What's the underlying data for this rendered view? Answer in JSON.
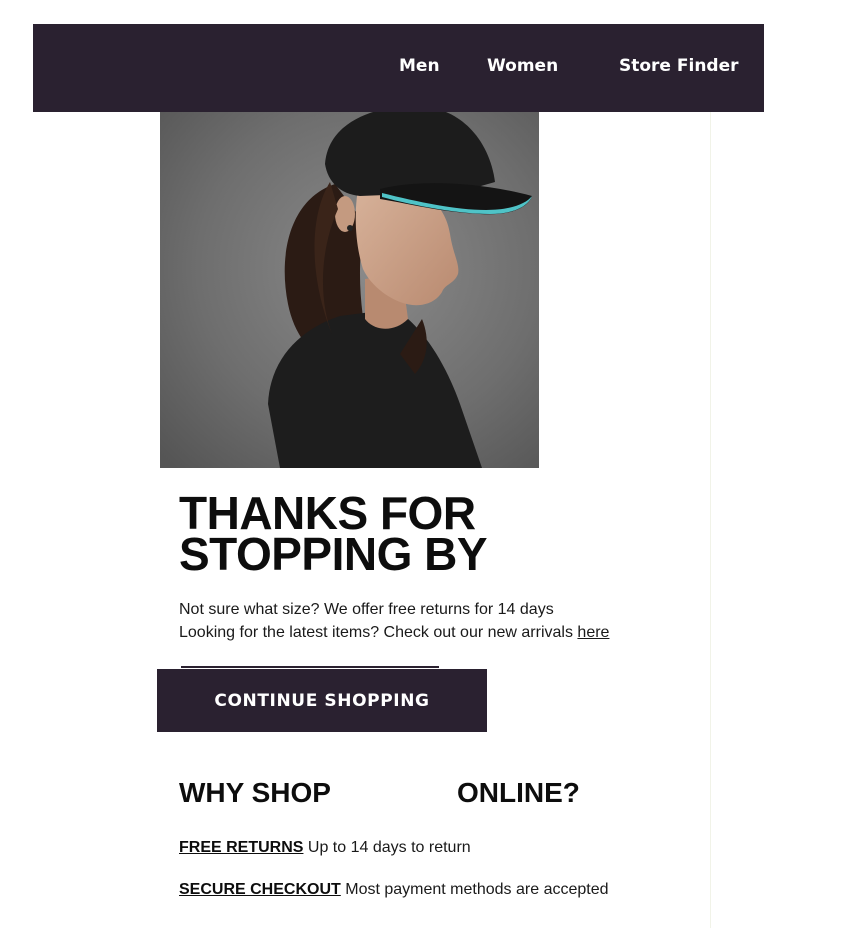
{
  "nav": {
    "links": [
      {
        "label": "Men"
      },
      {
        "label": "Women"
      },
      {
        "label": "Store Finder"
      }
    ],
    "background_color": "#2a2130"
  },
  "hero": {
    "description": "woman-in-black-cap-with-teal-brim"
  },
  "headline": {
    "line1": "THANKS FOR",
    "line2": "STOPPING BY"
  },
  "body": {
    "line1": "Not sure what size? We offer free returns for 14 days",
    "line2_prefix": "Looking for the latest items? Check out our new arrivals",
    "line2_link": "here"
  },
  "cta": {
    "label": "CONTINUE SHOPPING"
  },
  "why": {
    "heading_left": "WHY SHOP",
    "heading_right": "ONLINE?"
  },
  "benefits": [
    {
      "title": "FREE RETURNS",
      "text": "Up to 14 days to return"
    },
    {
      "title": "SECURE CHECKOUT",
      "text": "Most payment methods are accepted"
    }
  ],
  "colors": {
    "accent_dark": "#2a2130",
    "cap_brim_accent": "#4fc3c7"
  }
}
